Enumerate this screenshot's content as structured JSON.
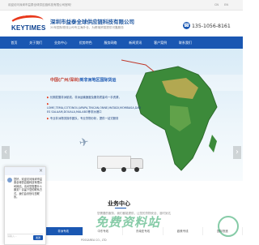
{
  "topbar": {
    "welcome": "欢迎访问深圳市益泰全球供应链科技有限公司官网！",
    "lang_cn": "CN",
    "lang_en": "EN"
  },
  "header": {
    "logo_text": "KEYTIMES",
    "company_name": "深圳市益泰全球供应链科技有限公司",
    "slogan": "20年国际物流公司专注海外仓、为跨境贸易提供可靠服务",
    "phone": "135-1056-8161"
  },
  "nav": {
    "items": [
      {
        "label": "首页"
      },
      {
        "label": "关于我们"
      },
      {
        "label": "业务中心"
      },
      {
        "label": "优势特色"
      },
      {
        "label": "服务网络"
      },
      {
        "label": "新闻资讯"
      },
      {
        "label": "客户案例"
      },
      {
        "label": "联系我们"
      }
    ]
  },
  "banner": {
    "title_part1": "中国(广州/深圳)",
    "title_part2": "到非洲地区国际货运",
    "bullets": [
      "长期发展非洲航线，非洲运输速度及服务质量均一手资源，",
      "LOME,TEMA,COTONOU,APAPA,TINCAN,ONNE,MATADI,MOMBASA,DAR ES SALAAM,DOUALA,MALABO等非洲港口",
      "专业非洲物流操作团队，专业货物分析，提供一站式服务"
    ]
  },
  "section": {
    "title": "业务中心",
    "desc": "您需要的服务，我们都能提供，让您的货物安全、准时到达"
  },
  "tabs": [
    {
      "label": "非洲专线"
    },
    {
      "label": "中东专线"
    },
    {
      "label": "东南亚专线"
    },
    {
      "label": "欧美专线"
    },
    {
      "label": "国际快递"
    }
  ],
  "service_line": "POSSAREA CO., LTD",
  "chat": {
    "message": "您好，欢迎访问深圳市益泰全球供应链科技有限公司网站，请问您需要什么服务？请留下您的联系方式，我们会尽快与您联系。",
    "input_placeholder": "请输入...",
    "send": "发送"
  },
  "watermark": "免费资料站"
}
